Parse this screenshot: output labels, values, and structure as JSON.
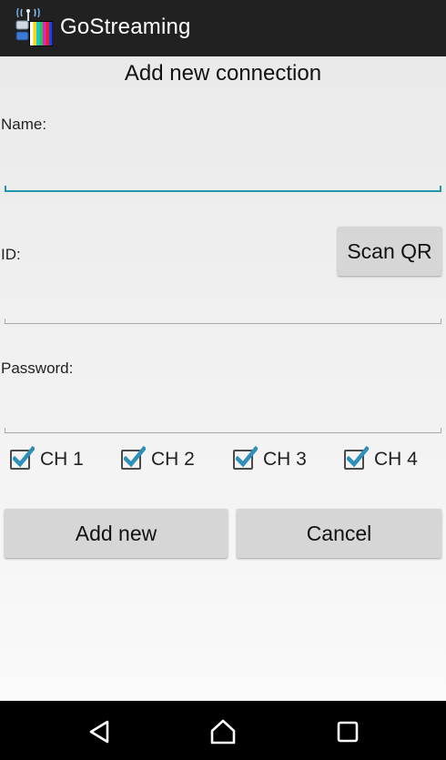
{
  "app": {
    "title": "GoStreaming",
    "icon": "app-logo-icon"
  },
  "dialog": {
    "title": "Add new connection"
  },
  "form": {
    "name_label": "Name:",
    "name_value": "",
    "id_label": "ID:",
    "id_value": "",
    "password_label": "Password:",
    "password_value": "",
    "scan_qr_label": "Scan QR"
  },
  "channels": [
    {
      "label": "CH 1",
      "checked": true
    },
    {
      "label": "CH 2",
      "checked": true
    },
    {
      "label": "CH 3",
      "checked": true
    },
    {
      "label": "CH 4",
      "checked": true
    }
  ],
  "actions": {
    "add_label": "Add new",
    "cancel_label": "Cancel"
  },
  "navigation": {
    "back_icon": "back-triangle-icon",
    "home_icon": "home-icon",
    "recents_icon": "recents-square-icon"
  },
  "colors": {
    "appbar": "#212121",
    "accent": "#2196a8",
    "button": "#d6d6d6",
    "check": "#2e8fb8"
  }
}
